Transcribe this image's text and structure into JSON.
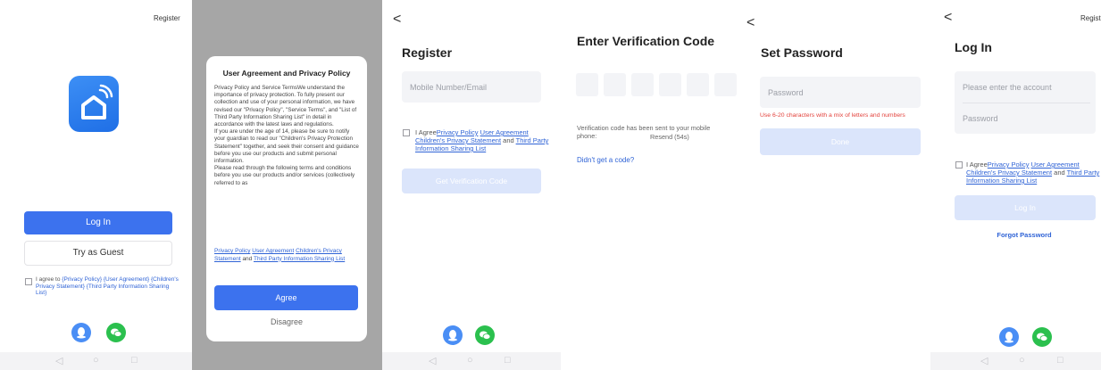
{
  "screen1": {
    "register_link": "Register",
    "login_button": "Log In",
    "guest_button": "Try as Guest",
    "agreement": {
      "prefix": "I agree to ",
      "privacy_policy": "{Privacy Policy}",
      "user_agreement": "{User Agreement}",
      "children_statement": "{Children's Privacy Statement}",
      "third_party": "{Third Party Information Sharing List}"
    }
  },
  "screen2": {
    "dialog_title": "User Agreement and Privacy Policy",
    "body": "Privacy Policy and Service TermsWe understand the importance of privacy protection. To fully present our collection and use of your personal information, we have revised our \"Privacy Policy\", \"Service Terms\", and \"List of Third Party Information Sharing List\" in detail in accordance with the latest laws and regulations.\nIf you are under the age of 14, please be sure to notify your guardian to read our \"Children's Privacy Protection Statement\" together, and seek their consent and guidance before you use our products and submit personal information.\nPlease read through the following terms and conditions before you use our products and/or services (collectively referred to as",
    "links": {
      "privacy_policy": "Privacy Policy",
      "user_agreement": "User Agreement",
      "children_statement": "Children's Privacy Statement",
      "and": " and ",
      "third_party": "Third Party Information Sharing List"
    },
    "agree_button": "Agree",
    "disagree_button": "Disagree"
  },
  "screen3": {
    "back": "<",
    "title": "Register",
    "input_placeholder": "Mobile Number/Email",
    "agreement": {
      "prefix": "I Agree",
      "privacy_policy": "Privacy Policy",
      "user_agreement": "User Agreement",
      "children_statement": "Children's Privacy Statement",
      "and": " and ",
      "third_party": "Third Party Information Sharing List"
    },
    "button": "Get Verification Code"
  },
  "screen4": {
    "title": "Enter Verification Code",
    "sent_text": "Verification code has been sent to your mobile phone:",
    "resend": "Resend (54s)",
    "no_code_link": "Didn't get a code?"
  },
  "screen5": {
    "back": "<",
    "title": "Set Password",
    "input_placeholder": "Password",
    "hint": "Use 6-20 characters with a mix of letters and numbers",
    "button": "Done"
  },
  "screen6": {
    "back": "<",
    "register_link": "Regist",
    "title": "Log In",
    "account_placeholder": "Please enter the account",
    "password_placeholder": "Password",
    "agreement": {
      "prefix": "I Agree",
      "privacy_policy": "Privacy Policy",
      "user_agreement": "User Agreement",
      "children_statement": "Children's Privacy Statement",
      "and": " and ",
      "third_party": "Third Party Information Sharing List"
    },
    "button": "Log In",
    "forgot_link": "Forgot Password"
  },
  "navbar": {
    "back_glyph": "◁",
    "home_glyph": "○",
    "recent_glyph": "□"
  },
  "icons": [
    "app-logo-icon",
    "qq-icon",
    "wechat-icon",
    "back-icon"
  ],
  "colors": {
    "primary": "#3c72ee",
    "primary_disabled": "#dbe5fb",
    "link": "#2f63d6",
    "error": "#e3423c",
    "input_bg": "#f3f4f7",
    "qq": "#4a8ef5",
    "wechat": "#2bc04e"
  }
}
